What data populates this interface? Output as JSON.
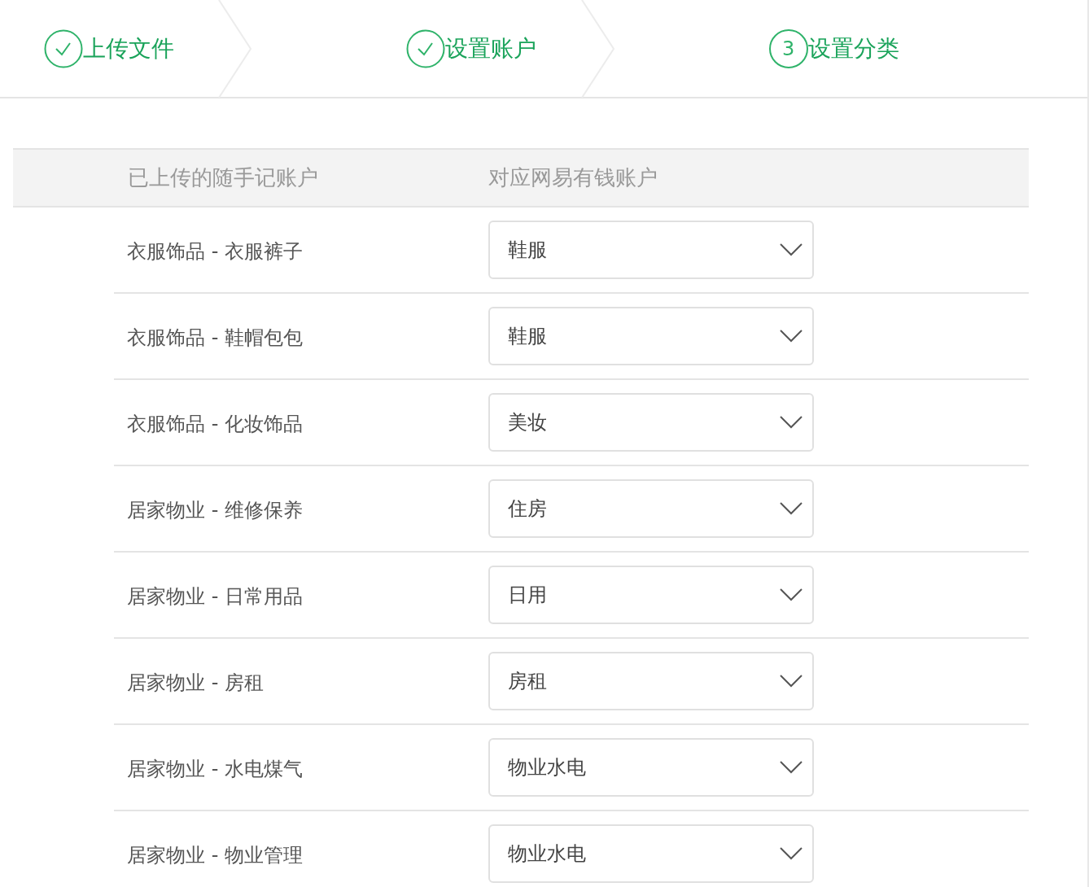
{
  "steps": [
    {
      "label": "上传文件",
      "done": true
    },
    {
      "label": "设置账户",
      "done": true
    },
    {
      "label": "设置分类",
      "done": false,
      "number": "3"
    }
  ],
  "table": {
    "columns": [
      "已上传的随手记账户",
      "对应网易有钱账户"
    ],
    "rows": [
      {
        "source": "衣服饰品 - 衣服裤子",
        "target": "鞋服"
      },
      {
        "source": "衣服饰品 - 鞋帽包包",
        "target": "鞋服"
      },
      {
        "source": "衣服饰品 - 化妆饰品",
        "target": "美妆"
      },
      {
        "source": "居家物业 - 维修保养",
        "target": "住房"
      },
      {
        "source": "居家物业 - 日常用品",
        "target": "日用"
      },
      {
        "source": "居家物业 - 房租",
        "target": "房租"
      },
      {
        "source": "居家物业 - 水电煤气",
        "target": "物业水电"
      },
      {
        "source": "居家物业 - 物业管理",
        "target": "物业水电"
      }
    ]
  }
}
